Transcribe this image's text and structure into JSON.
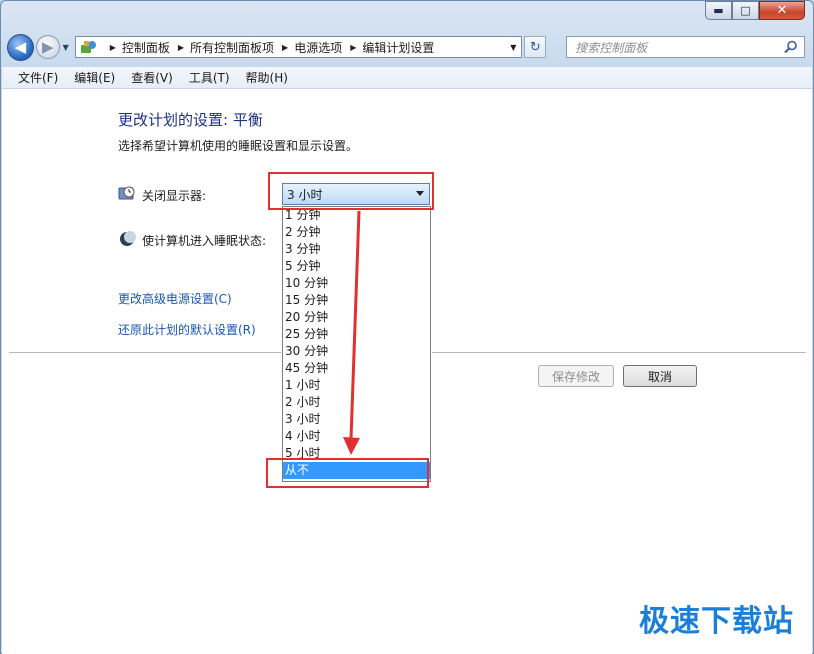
{
  "window": {
    "caption_buttons": {
      "minimize": "▬",
      "maximize": "□",
      "close": "✕"
    }
  },
  "nav": {
    "back_glyph": "◀",
    "forward_glyph": "▶",
    "breadcrumb": [
      "控制面板",
      "所有控制面板项",
      "电源选项",
      "编辑计划设置"
    ],
    "search_placeholder": "搜索控制面板"
  },
  "menu": [
    "文件(F)",
    "编辑(E)",
    "查看(V)",
    "工具(T)",
    "帮助(H)"
  ],
  "page": {
    "title": "更改计划的设置: 平衡",
    "subtitle": "选择希望计算机使用的睡眠设置和显示设置。",
    "display_label": "关闭显示器:",
    "sleep_label": "使计算机进入睡眠状态:",
    "display_value": "3 小时",
    "dropdown_options": [
      "1 分钟",
      "2 分钟",
      "3 分钟",
      "5 分钟",
      "10 分钟",
      "15 分钟",
      "20 分钟",
      "25 分钟",
      "30 分钟",
      "45 分钟",
      "1 小时",
      "2 小时",
      "3 小时",
      "4 小时",
      "5 小时",
      "从不"
    ],
    "selected_option": "从不",
    "link_advanced": "更改高级电源设置(C)",
    "link_restore": "还原此计划的默认设置(R)",
    "save_button": "保存修改",
    "cancel_button": "取消"
  },
  "watermark": "极速下载站",
  "colors": {
    "highlight": "#3399ff",
    "annotation": "#e03030",
    "link": "#1a56b5",
    "title": "#1e3287"
  }
}
